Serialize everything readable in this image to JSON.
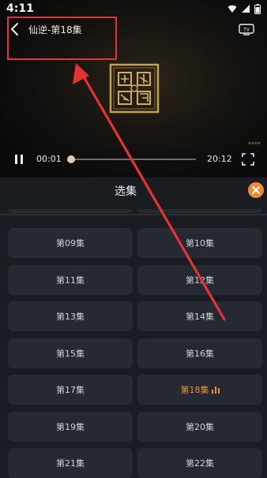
{
  "status_bar": {
    "time": "4:11"
  },
  "player": {
    "title": "仙逆-第18集",
    "current_time": "00:01",
    "total_time": "20:12",
    "progress_fraction": 0.01
  },
  "panel": {
    "title": "选集",
    "episodes": [
      {
        "label": "第09集",
        "active": false
      },
      {
        "label": "第10集",
        "active": false
      },
      {
        "label": "第11集",
        "active": false
      },
      {
        "label": "第12集",
        "active": false
      },
      {
        "label": "第13集",
        "active": false
      },
      {
        "label": "第14集",
        "active": false
      },
      {
        "label": "第15集",
        "active": false
      },
      {
        "label": "第16集",
        "active": false
      },
      {
        "label": "第17集",
        "active": false
      },
      {
        "label": "第18集",
        "active": true
      },
      {
        "label": "第19集",
        "active": false
      },
      {
        "label": "第20集",
        "active": false
      },
      {
        "label": "第21集",
        "active": false
      },
      {
        "label": "第22集",
        "active": false
      }
    ]
  },
  "colors": {
    "accent": "#f0902e",
    "annotation": "#e63232",
    "panel_bg": "#1a1c22",
    "button_bg": "#262931"
  }
}
